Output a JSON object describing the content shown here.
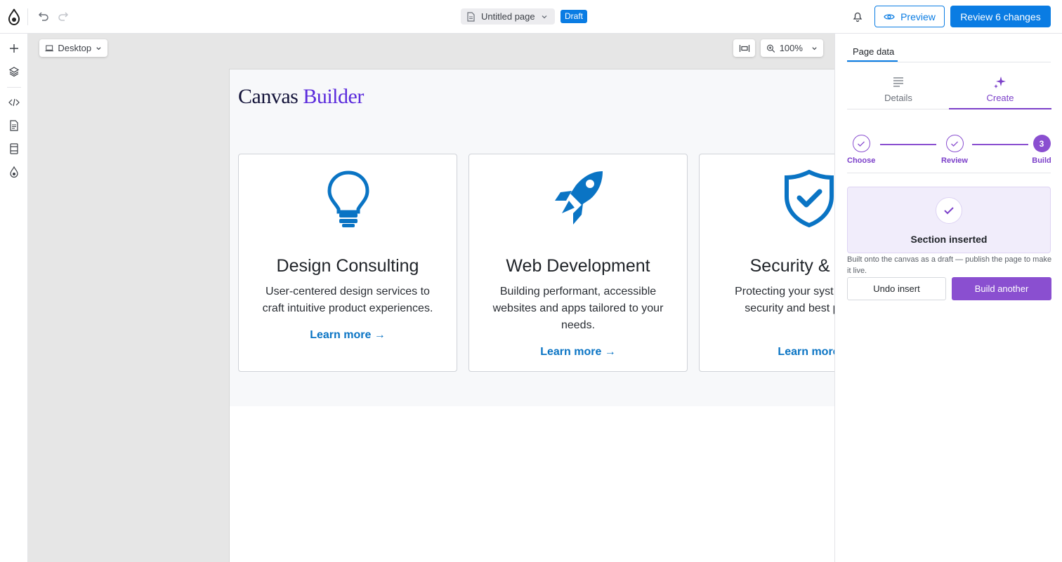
{
  "topbar": {
    "page_title": "Untitled page",
    "status_badge": "Draft",
    "preview_label": "Preview",
    "review_label": "Review 6 changes"
  },
  "canvas": {
    "device": "Desktop",
    "zoom": "100%"
  },
  "site": {
    "brand_part1": "Canvas",
    "brand_part2": "Builder",
    "cards": [
      {
        "icon": "lightbulb-icon",
        "title": "Design Consulting",
        "text": "User-centered design services to craft intuitive product experiences.",
        "link": "Learn more →"
      },
      {
        "icon": "rocket-icon",
        "title": "Web Development",
        "text": "Building performant, accessible websites and apps tailored to your needs.",
        "link": "Learn more →"
      },
      {
        "icon": "shield-check-icon",
        "title": "Security & Con",
        "text": "Protecting your syst proactive security and best practice",
        "link": "Learn more"
      }
    ]
  },
  "panel": {
    "tab": "Page data",
    "subtabs": {
      "details": "Details",
      "create": "Create"
    },
    "steps": [
      {
        "label": "Choose",
        "state": "done"
      },
      {
        "label": "Review",
        "state": "done"
      },
      {
        "label": "Build",
        "state": "current",
        "number": "3"
      }
    ],
    "success_message": "Section inserted",
    "note": "Built onto the canvas as a draft — publish the page to make it live.",
    "undo_label": "Undo insert",
    "build_label": "Build another"
  },
  "colors": {
    "accent_blue": "#0a7ce3",
    "accent_purple": "#8a4fd0",
    "link_blue": "#0a74c4"
  }
}
